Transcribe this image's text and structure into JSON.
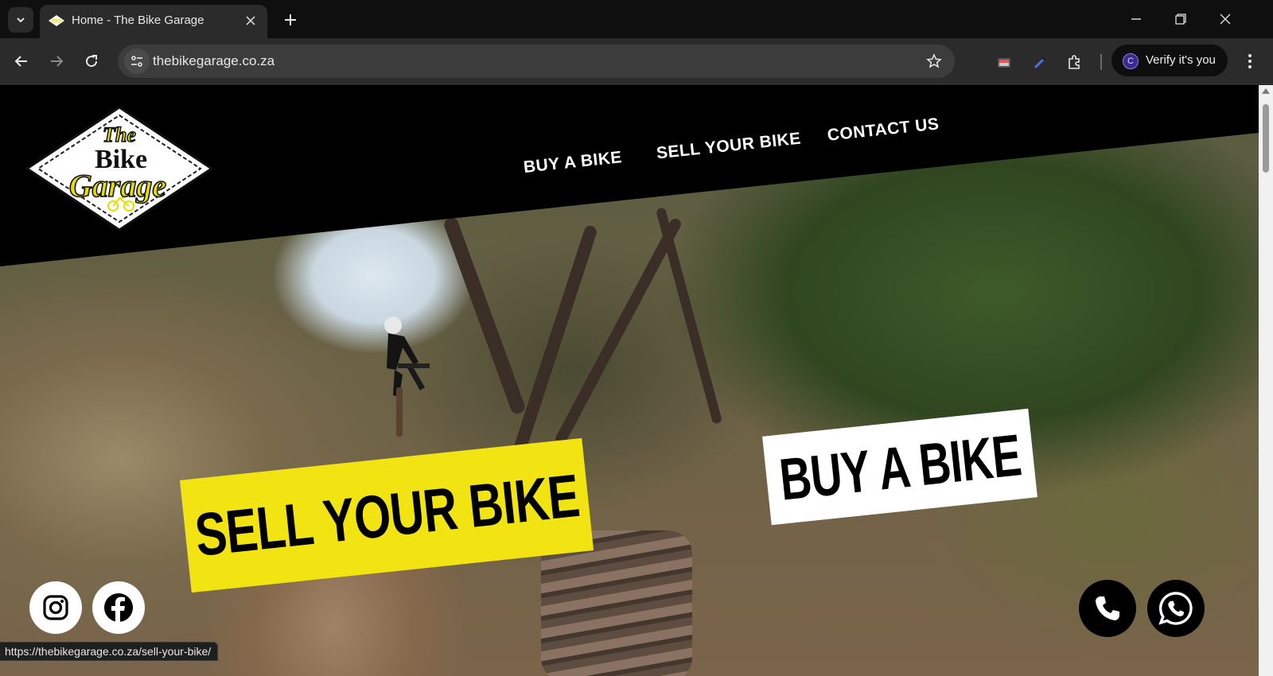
{
  "browser": {
    "tab": {
      "title": "Home - The Bike Garage",
      "favicon": "bike-garage-favicon"
    },
    "address": {
      "url": "thebikegarage.co.za"
    },
    "profile": {
      "avatar_letter": "C",
      "label": "Verify it's you"
    },
    "status_url": "https://thebikegarage.co.za/sell-your-bike/"
  },
  "site": {
    "logo": {
      "line1": "The",
      "line2": "Bike",
      "line3": "Garage"
    },
    "nav": [
      {
        "label": "BUY A BIKE"
      },
      {
        "label": "SELL YOUR BIKE"
      },
      {
        "label": "CONTACT US"
      }
    ],
    "hero": {
      "sell_cta": "SELL YOUR BIKE",
      "buy_cta": "BUY A BIKE"
    },
    "social": [
      "instagram-icon",
      "facebook-icon"
    ],
    "contact": [
      "phone-icon",
      "whatsapp-icon"
    ],
    "colors": {
      "brand_yellow": "#f1e412",
      "header_black": "#000000"
    }
  }
}
